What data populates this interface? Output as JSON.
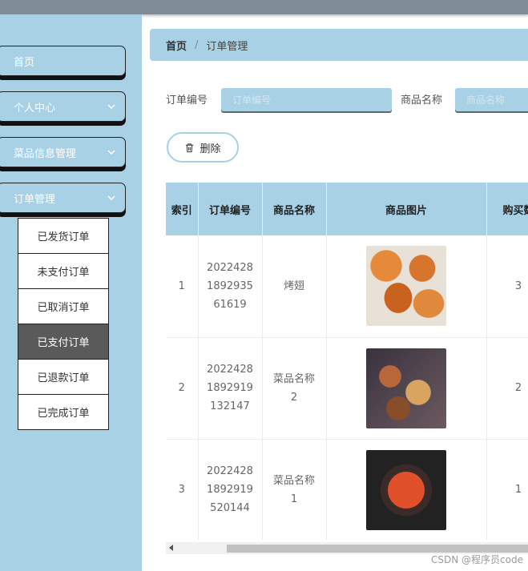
{
  "sidebar": {
    "items": [
      {
        "label": "首页",
        "has_chevron": false
      },
      {
        "label": "个人中心",
        "has_chevron": true
      },
      {
        "label": "菜品信息管理",
        "has_chevron": true
      },
      {
        "label": "订单管理",
        "has_chevron": true,
        "expanded": true
      }
    ],
    "submenu": [
      {
        "label": "已发货订单",
        "active": false
      },
      {
        "label": "未支付订单",
        "active": false
      },
      {
        "label": "已取消订单",
        "active": false
      },
      {
        "label": "已支付订单",
        "active": true
      },
      {
        "label": "已退款订单",
        "active": false
      },
      {
        "label": "已完成订单",
        "active": false
      }
    ]
  },
  "breadcrumb": {
    "home": "首页",
    "separator": "/",
    "current": "订单管理"
  },
  "search": {
    "order_no_label": "订单编号",
    "order_no_placeholder": "订单编号",
    "product_name_label": "商品名称",
    "product_name_placeholder": "商品名称"
  },
  "actions": {
    "delete_label": "删除"
  },
  "table": {
    "headers": [
      "索引",
      "订单编号",
      "商品名称",
      "商品图片",
      "购买数"
    ],
    "rows": [
      {
        "index": "1",
        "order_no": [
          "2022428",
          "1892935",
          "61619"
        ],
        "product": [
          "烤翅"
        ],
        "qty": "3"
      },
      {
        "index": "2",
        "order_no": [
          "2022428",
          "1892919",
          "132147"
        ],
        "product": [
          "菜品名称",
          "2"
        ],
        "qty": "2"
      },
      {
        "index": "3",
        "order_no": [
          "2022428",
          "1892919",
          "520144"
        ],
        "product": [
          "菜品名称",
          "1"
        ],
        "qty": "1"
      }
    ]
  },
  "watermark": "CSDN @程序员code",
  "colors": {
    "accent": "#a8d1e6",
    "active_submenu": "#5a5a5a"
  }
}
